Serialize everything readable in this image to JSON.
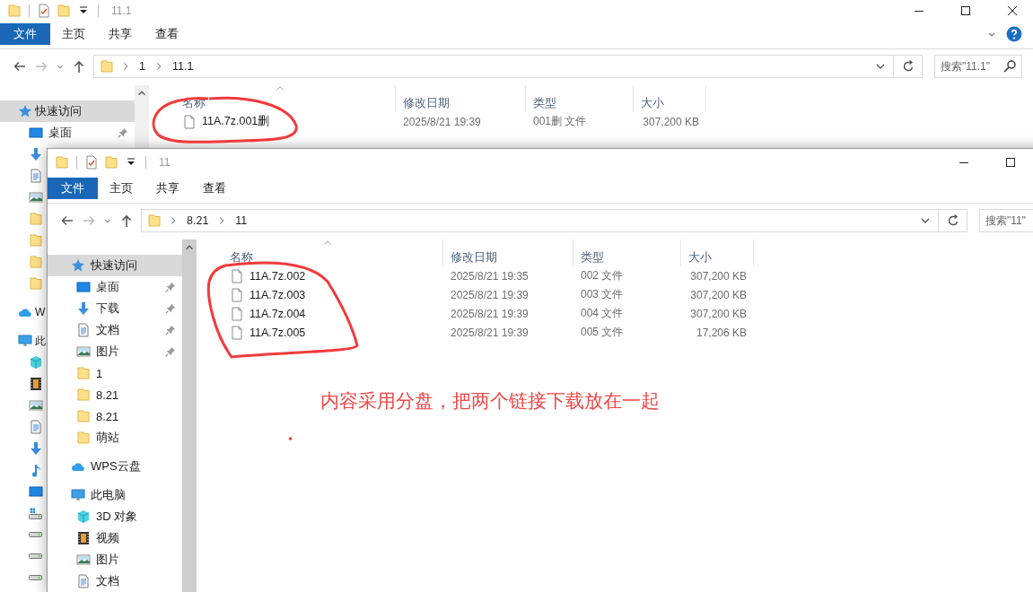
{
  "windows": [
    {
      "title": "11.1",
      "ribbon": [
        {
          "label": "文件",
          "kind": "menu"
        },
        {
          "label": "主页",
          "kind": "tab"
        },
        {
          "label": "共享",
          "kind": "tab"
        },
        {
          "label": "查看",
          "kind": "tab"
        }
      ],
      "path": [
        "1",
        "11.1"
      ],
      "search": {
        "placeholder": "搜索\"11.1\""
      },
      "sidebar": [
        {
          "kind": "star",
          "label": "快速访问",
          "selected": true,
          "children": [
            {
              "kind": "desktop",
              "label": "桌面",
              "selected": false,
              "pinned": true
            },
            {
              "kind": "download",
              "selected": false,
              "pinned": false
            },
            {
              "kind": "document",
              "selected": false,
              "pinned": false
            },
            {
              "kind": "picture",
              "selected": false,
              "pinned": false
            },
            {
              "kind": "folder",
              "selected": false,
              "pinned": false
            },
            {
              "kind": "folder",
              "selected": false,
              "pinned": false
            },
            {
              "kind": "folder",
              "selected": false,
              "pinned": false
            },
            {
              "kind": "folder",
              "selected": false,
              "pinned": false
            }
          ]
        },
        {
          "kind": "cloud",
          "label": "W",
          "selected": false
        },
        {
          "kind": "computer",
          "label": "此",
          "selected": false,
          "children": [
            {
              "kind": "cube",
              "selected": false,
              "pinned": false
            },
            {
              "kind": "film",
              "selected": false,
              "pinned": false
            },
            {
              "kind": "picture",
              "selected": false,
              "pinned": false
            },
            {
              "kind": "document",
              "selected": false,
              "pinned": false
            },
            {
              "kind": "download",
              "selected": false,
              "pinned": false
            },
            {
              "kind": "music",
              "selected": false,
              "pinned": false
            },
            {
              "kind": "desktop",
              "selected": false,
              "pinned": false
            },
            {
              "kind": "system-drive",
              "selected": false,
              "pinned": false
            },
            {
              "kind": "drive",
              "selected": false,
              "pinned": false
            },
            {
              "kind": "drive",
              "selected": false,
              "pinned": false
            },
            {
              "kind": "drive",
              "selected": false,
              "pinned": false
            }
          ]
        }
      ],
      "columns": [
        "名称",
        "修改日期",
        "类型",
        "大小"
      ],
      "files": [
        {
          "name": "11A.7z.001删",
          "modified": "2025/8/21 19:39",
          "type": "001删 文件",
          "size": "307,200 KB"
        }
      ]
    },
    {
      "title": "11",
      "ribbon": [
        {
          "label": "文件",
          "kind": "menu"
        },
        {
          "label": "主页",
          "kind": "tab"
        },
        {
          "label": "共享",
          "kind": "tab"
        },
        {
          "label": "查看",
          "kind": "tab"
        }
      ],
      "path": [
        "8.21",
        "11"
      ],
      "search": {
        "placeholder": "搜索\"11\""
      },
      "sidebar": [
        {
          "kind": "star",
          "label": "快速访问",
          "selected": true,
          "children": [
            {
              "kind": "desktop",
              "label": "桌面",
              "selected": false,
              "pinned": true
            },
            {
              "kind": "download",
              "label": "下载",
              "selected": false,
              "pinned": true
            },
            {
              "kind": "document",
              "label": "文档",
              "selected": false,
              "pinned": true
            },
            {
              "kind": "picture",
              "label": "图片",
              "selected": false,
              "pinned": true
            },
            {
              "kind": "folder",
              "label": "1",
              "selected": false,
              "pinned": false
            },
            {
              "kind": "folder",
              "label": "8.21",
              "selected": false,
              "pinned": false
            },
            {
              "kind": "folder",
              "label": "8.21",
              "selected": false,
              "pinned": false
            },
            {
              "kind": "folder",
              "label": "萌站",
              "selected": false,
              "pinned": false
            }
          ]
        },
        {
          "kind": "cloud",
          "label": "WPS云盘",
          "selected": false
        },
        {
          "kind": "computer",
          "label": "此电脑",
          "selected": false,
          "children": [
            {
              "kind": "cube",
              "label": "3D 对象",
              "selected": false,
              "pinned": false
            },
            {
              "kind": "film",
              "label": "视频",
              "selected": false,
              "pinned": false
            },
            {
              "kind": "picture",
              "label": "图片",
              "selected": false,
              "pinned": false
            },
            {
              "kind": "document",
              "label": "文档",
              "selected": false,
              "pinned": false
            }
          ]
        }
      ],
      "columns": [
        "名称",
        "修改日期",
        "类型",
        "大小"
      ],
      "files": [
        {
          "name": "11A.7z.002",
          "modified": "2025/8/21 19:35",
          "type": "002 文件",
          "size": "307,200 KB"
        },
        {
          "name": "11A.7z.003",
          "modified": "2025/8/21 19:39",
          "type": "003 文件",
          "size": "307,200 KB"
        },
        {
          "name": "11A.7z.004",
          "modified": "2025/8/21 19:39",
          "type": "004 文件",
          "size": "307,200 KB"
        },
        {
          "name": "11A.7z.005",
          "modified": "2025/8/21 19:39",
          "type": "005 文件",
          "size": "17,206 KB"
        }
      ]
    }
  ],
  "annotation": {
    "note": "内容采用分盘，把两个链接下载放在一起"
  }
}
